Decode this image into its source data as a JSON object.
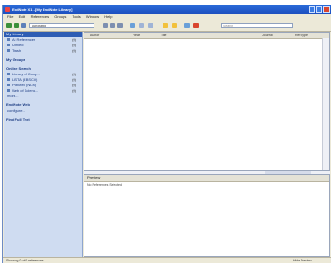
{
  "window": {
    "title": "EndNote X1 - [My EndNote Library]"
  },
  "menubar": [
    "File",
    "Edit",
    "References",
    "Groups",
    "Tools",
    "Window",
    "Help"
  ],
  "toolbar": {
    "style_value": "Annotated",
    "search_placeholder": "Search"
  },
  "sidebar": {
    "header": "My Library",
    "top_items": [
      {
        "label": "All References",
        "count": "(0)"
      },
      {
        "label": "Unfiled",
        "count": "(0)"
      },
      {
        "label": "Trash",
        "count": "(0)"
      }
    ],
    "my_groups_label": "My Groups",
    "online_search_label": "Online Search",
    "online_items": [
      {
        "label": "Library of Cong...",
        "count": "(0)"
      },
      {
        "label": "LISTA (EBSCO)",
        "count": "(0)"
      },
      {
        "label": "PubMed (NLM)",
        "count": "(0)"
      },
      {
        "label": "Web of Scienc...",
        "count": "(0)"
      },
      {
        "label": "more...",
        "count": ""
      }
    ],
    "endnote_web_label": "EndNote Web",
    "configure_label": "configure...",
    "find_full_text_label": "Find Full Text"
  },
  "columns": [
    "Author",
    "Year",
    "Title",
    "Journal",
    "Ref Type"
  ],
  "preview": {
    "header": "Preview",
    "body": "No References Selected"
  },
  "statusbar": {
    "left": "Showing 0 of 0 references.",
    "right": "Hide Preview"
  }
}
